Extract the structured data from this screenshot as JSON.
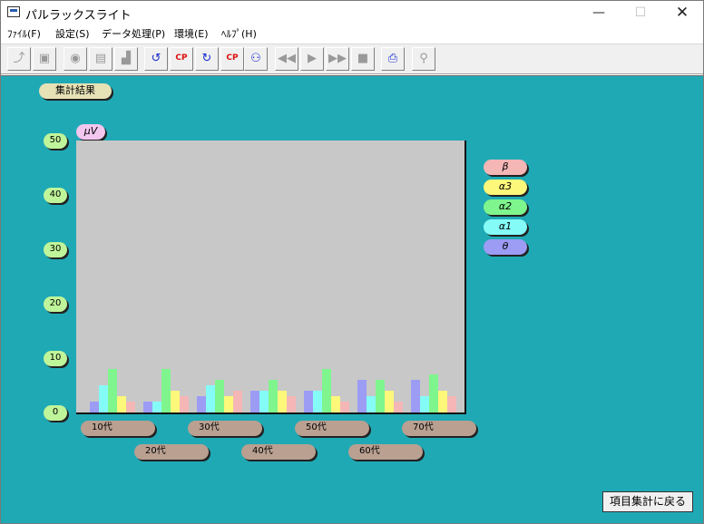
{
  "window": {
    "title": "パルラックスライト",
    "controls": {
      "minimize": "—",
      "maximize": "☐",
      "close": "✕"
    }
  },
  "menu": [
    {
      "label": "ﾌｧｲﾙ(F)"
    },
    {
      "label": "設定(S)"
    },
    {
      "label": "データ処理(P)"
    },
    {
      "label": "環境(E)"
    },
    {
      "label": "ﾍﾙﾌﾟ(H)"
    }
  ],
  "toolbar": {
    "buttons": [
      {
        "icon": "open-folder-icon",
        "glyph": "⤴",
        "enabled": false
      },
      {
        "icon": "save-disk-icon",
        "glyph": "▣",
        "enabled": false
      },
      {
        "icon": "user-profile-icon",
        "glyph": "◉",
        "enabled": false
      },
      {
        "icon": "record-list-icon",
        "glyph": "▤",
        "enabled": false
      },
      {
        "icon": "histogram-icon",
        "glyph": "▟",
        "enabled": false
      },
      {
        "icon": "return-arrow-icon",
        "glyph": "↺",
        "enabled": true
      },
      {
        "icon": "cp-icon",
        "glyph": "CP",
        "enabled": true
      },
      {
        "icon": "refresh-icon",
        "glyph": "↻",
        "enabled": true
      },
      {
        "icon": "cp-refresh-icon",
        "glyph": "CP",
        "enabled": true
      },
      {
        "icon": "measure-device-icon",
        "glyph": "⚇",
        "enabled": true
      },
      {
        "icon": "rewind-icon",
        "glyph": "◀◀",
        "enabled": false
      },
      {
        "icon": "play-icon",
        "glyph": "▶",
        "enabled": false
      },
      {
        "icon": "fast-forward-icon",
        "glyph": "▶▶",
        "enabled": false
      },
      {
        "icon": "stop-icon",
        "glyph": "■",
        "enabled": false
      },
      {
        "icon": "printer-icon",
        "glyph": "⎙",
        "enabled": true
      },
      {
        "icon": "probe-icon",
        "glyph": "⚲",
        "enabled": false
      }
    ]
  },
  "colors": {
    "background": "#1fa9b5",
    "plot_bg": "#c8c8c8",
    "beta": "#f5b6b6",
    "alpha3": "#fdf77a",
    "alpha2": "#7ff58d",
    "alpha1": "#85fbf8",
    "theta": "#9c9cf5"
  },
  "summary_label": "集計結果",
  "back_button": "項目集計に戻る",
  "chart_data": {
    "type": "bar",
    "unit_label": "μV",
    "ylim": [
      0,
      50
    ],
    "yticks": [
      "50",
      "40",
      "30",
      "20",
      "10",
      "0"
    ],
    "categories": [
      "10代",
      "20代",
      "30代",
      "40代",
      "50代",
      "60代",
      "70代"
    ],
    "series": [
      {
        "name": "θ",
        "key": "theta",
        "values": [
          2,
          2,
          3,
          4,
          4,
          6,
          6
        ]
      },
      {
        "name": "α1",
        "key": "alpha1",
        "values": [
          5,
          2,
          5,
          4,
          4,
          3,
          3
        ]
      },
      {
        "name": "α2",
        "key": "alpha2",
        "values": [
          8,
          8,
          6,
          6,
          8,
          6,
          7
        ]
      },
      {
        "name": "α3",
        "key": "alpha3",
        "values": [
          3,
          4,
          3,
          4,
          3,
          4,
          4
        ]
      },
      {
        "name": "β",
        "key": "beta",
        "values": [
          2,
          3,
          4,
          3,
          2,
          2,
          3
        ]
      }
    ],
    "legend_order": [
      "β",
      "α3",
      "α2",
      "α1",
      "θ"
    ],
    "legend_placement": "right",
    "grid": false
  }
}
